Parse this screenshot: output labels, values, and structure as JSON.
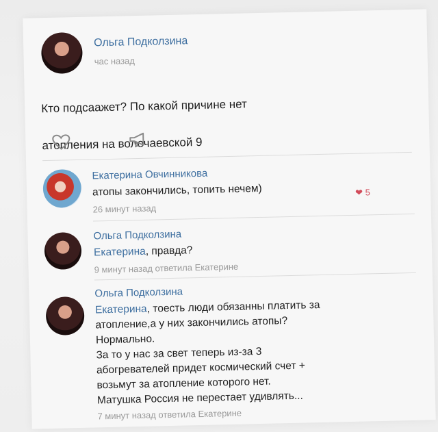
{
  "post": {
    "author": "Ольга Подколзина",
    "time": "час назад",
    "text_line1": "Кто подсаажет? По какой причине нет",
    "text_line2": "атопления на волочаевской 9",
    "like_icon": "heart-outline-icon",
    "share_icon": "megaphone-icon"
  },
  "comments": [
    {
      "author": "Екатерина Овчинникова",
      "text": "атопы закончились, топить нечем)",
      "meta": "26 минут назад",
      "likes": "5",
      "like_icon": "heart-filled-icon"
    },
    {
      "author": "Ольга Подколзина",
      "mention": "Екатерина",
      "text": ", правда?",
      "meta": "9 минут назад ответила Екатерине"
    },
    {
      "author": "Ольга Подколзина",
      "mention": "Екатерина",
      "text_lines": [
        ", тоесть люди обязанны платить за",
        "атопление,а у них закончились атопы?",
        "Нормально.",
        "За то у нас за свет теперь из-за 3",
        "абогревателей придет космический счет +",
        "возьмут за атопление которого нет.",
        "Матушка Россия не перестает удивлять..."
      ],
      "meta": "7 минут назад ответила Екатерине"
    }
  ],
  "colors": {
    "link": "#3e6fa0",
    "meta": "#9a9a9a",
    "like": "#d24b5a"
  }
}
